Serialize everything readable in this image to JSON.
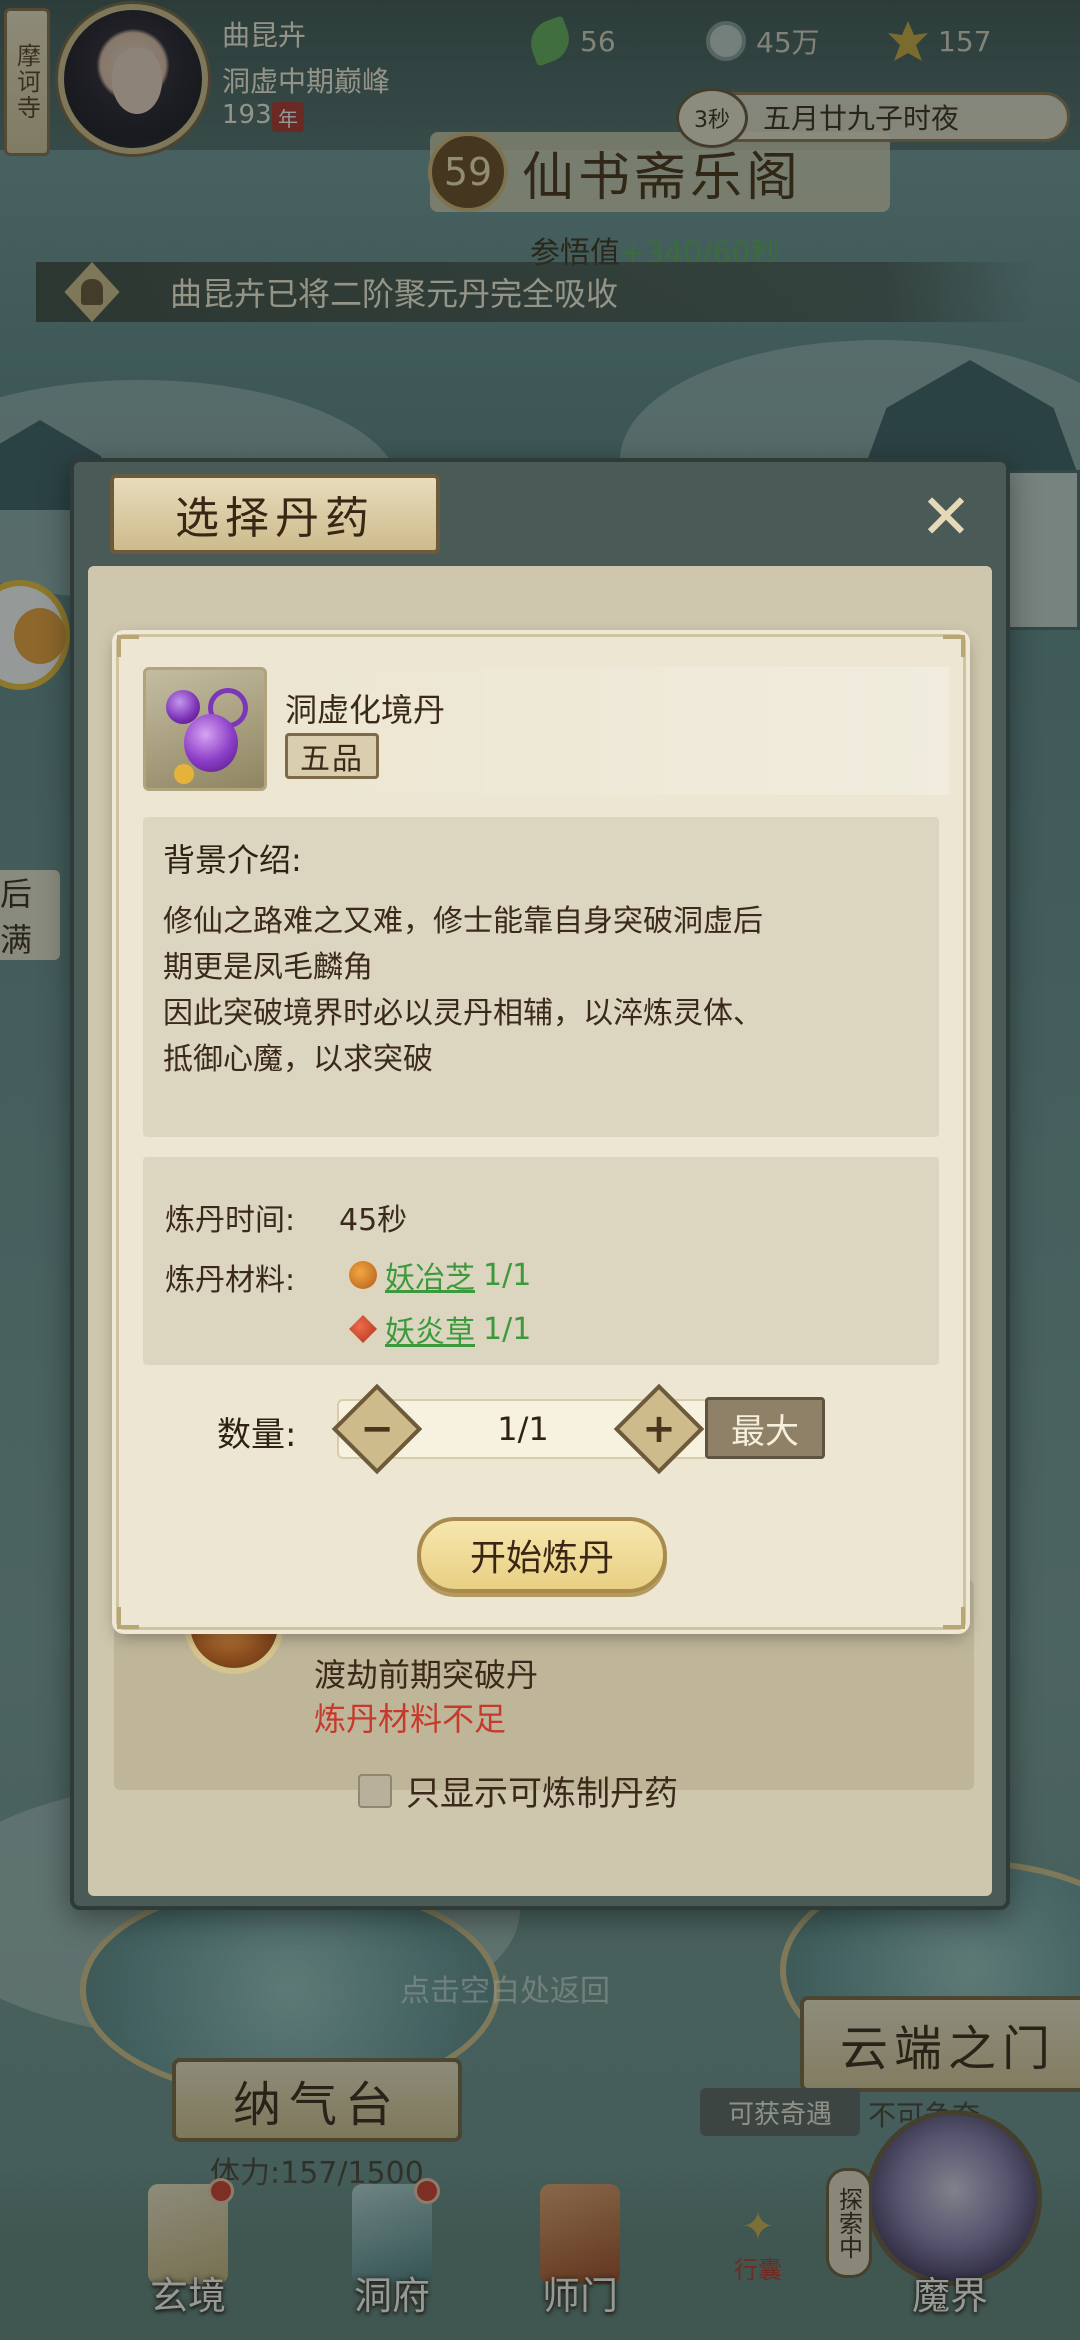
{
  "header": {
    "temple_name": "摩诃寺",
    "player_name": "曲昆卉",
    "realm": "洞虚中期巅峰",
    "age_value": "193",
    "age_unit": "年",
    "resources": [
      {
        "icon": "leaf-icon",
        "value": "56"
      },
      {
        "icon": "coin-icon",
        "value": "45万"
      },
      {
        "icon": "gold-ingot-icon",
        "value": "157"
      }
    ],
    "timer": "3秒",
    "game_time": "五月廿九子时夜"
  },
  "hall": {
    "level": "59",
    "title": "仙书斋乐阁",
    "insight_label": "参悟值",
    "insight_value": "+340/60秒"
  },
  "notice": {
    "text": "曲昆卉已将二阶聚元丹完全吸收"
  },
  "side": {
    "label": "后满"
  },
  "dialog": {
    "title": "选择丹药",
    "close_icon": "close-icon",
    "list_item": {
      "name": "渡劫前期突破丹",
      "status": "炼丹材料不足"
    },
    "filter_label": "只显示可炼制丹药"
  },
  "pill_detail": {
    "name": "洞虚化境丹",
    "grade": "五品",
    "background_title": "背景介绍:",
    "background_lines": [
      "修仙之路难之又难，修士能靠自身突破洞虚后",
      "期更是凤毛麟角",
      "因此突破境界时必以灵丹相辅，以淬炼灵体、",
      "抵御心魔，以求突破"
    ],
    "time_label": "炼丹时间:",
    "time_value": "45秒",
    "materials_label": "炼丹材料:",
    "materials": [
      {
        "name": "妖冶芝",
        "count": "1/1",
        "icon": "mushroom-icon"
      },
      {
        "name": "妖炎草",
        "count": "1/1",
        "icon": "herb-icon"
      }
    ],
    "quantity_label": "数量:",
    "quantity_value": "1/1",
    "max_label": "最大",
    "start_label": "开始炼丹"
  },
  "bottom": {
    "back_hint": "点击空白处返回",
    "naqi_title": "纳气台",
    "stamina": "体力:157/1500",
    "cloud_gate_title": "云端之门",
    "reward_label": "可获奇遇",
    "reward_text": "不可争夺",
    "explore_tag": "探索中",
    "xingnang_label": "行囊"
  },
  "nav": [
    {
      "label": "玄境",
      "dot": true
    },
    {
      "label": "洞府",
      "dot": true
    },
    {
      "label": "师门",
      "dot": false
    },
    {
      "label": "魔界",
      "dot": false
    }
  ],
  "colors": {
    "accent_green": "#3d9a3c",
    "warning_red": "#c53a2c",
    "panel_bg": "#ece6d2"
  }
}
